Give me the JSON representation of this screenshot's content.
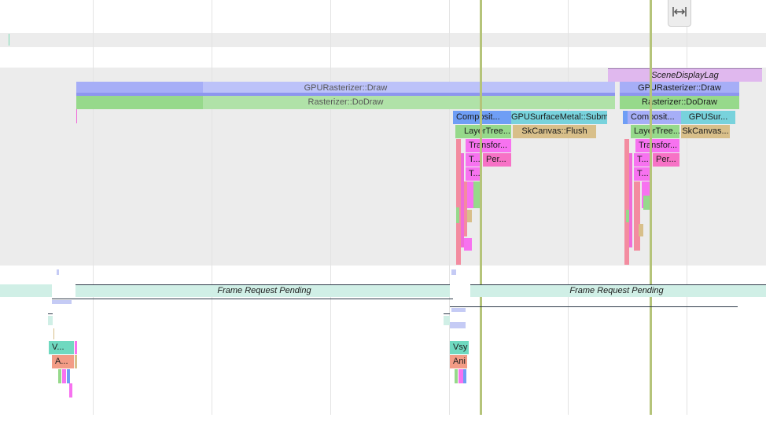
{
  "timeline": {
    "scene_display_lag": "SceneDisplayLag",
    "frame_request_pending": "Frame Request Pending"
  },
  "raster": {
    "gpu_draw_1": "GPURasterizer::Draw",
    "dodraw_1": "Rasterizer::DoDraw",
    "composite_1": "Composit...",
    "gpu_submit_1": "GPUSurfaceMetal::Submit",
    "layertree_1": "LayerTree...",
    "flush_1": "SkCanvas::Flush",
    "transform_1": "Transfor...",
    "t_a_1": "T...",
    "per_1": "Per...",
    "t_b_1": "T...",
    "gpu_draw_2": "GPURasterizer::Draw",
    "dodraw_2": "Rasterizer::DoDraw",
    "composite_2": "Composit...",
    "gpu_sur_2": "GPUSur...",
    "layertree_2": "LayerTree...",
    "canvas_2": "SkCanvas...",
    "transform_2": "Transfor...",
    "t_a_2": "T...",
    "per_2": "Per...",
    "t_b_2": "T..."
  },
  "ui": {
    "v_1": "V...",
    "a_1": "A...",
    "vsy_2": "Vsy",
    "ani_2": "Ani"
  },
  "toolbar": {
    "fit_icon": "fit-width-icon"
  },
  "colors": {
    "gpu_draw": "#a6aef7",
    "dodraw": "#96d98b",
    "composite": "#6f9ef5",
    "submit": "#78d2dc",
    "layertree": "#96d98b",
    "flush": "#d8bf8a",
    "transform": "#f772f0",
    "per": "#f772c6",
    "scene_lag": "#e0b8ee",
    "frame_pending": "#d0efe6",
    "vsync": "#6fd9c0",
    "anim": "#f39c86",
    "marker": "#b5c47a"
  }
}
